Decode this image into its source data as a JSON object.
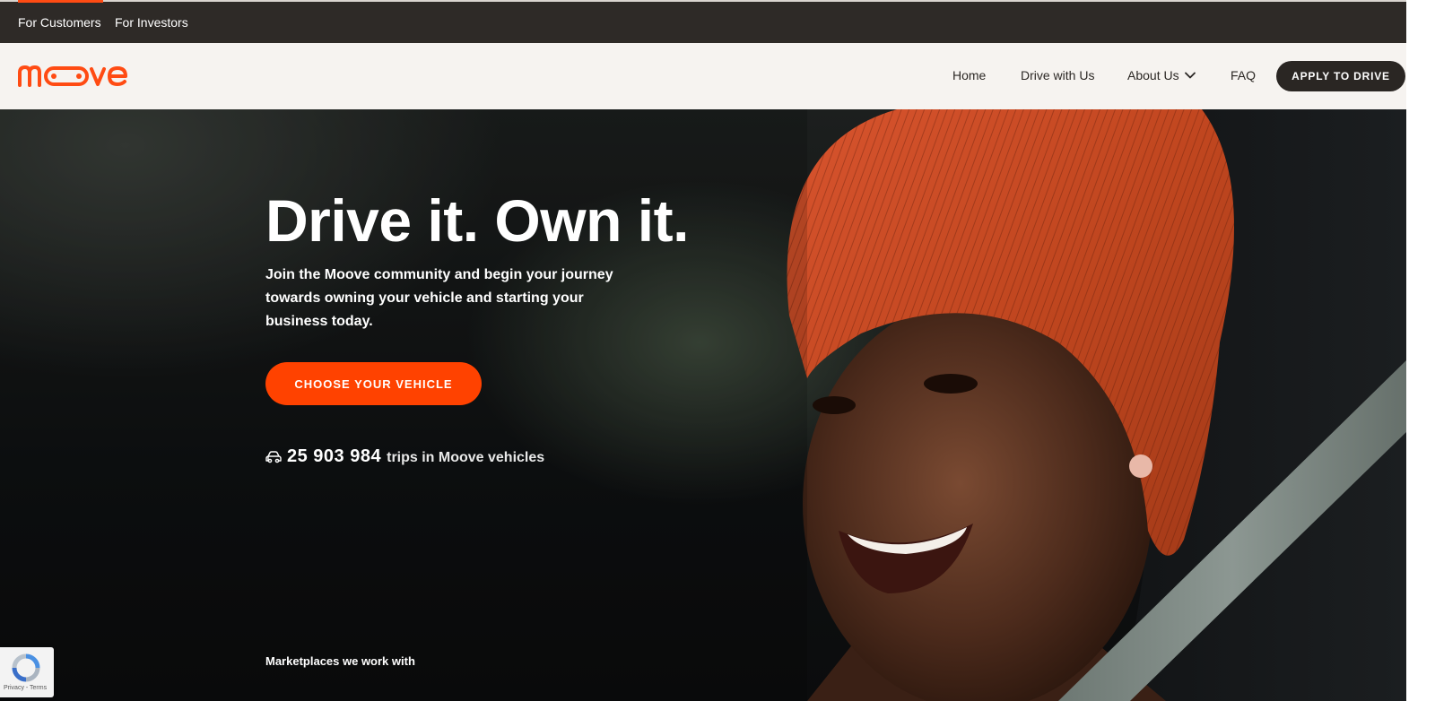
{
  "topbar": {
    "tabs": [
      {
        "label": "For Customers",
        "active": true
      },
      {
        "label": "For Investors",
        "active": false
      }
    ]
  },
  "brand": {
    "name": "moove",
    "accent_color": "#ff4b13"
  },
  "nav": {
    "items": [
      {
        "label": "Home"
      },
      {
        "label": "Drive with Us"
      },
      {
        "label": "About Us",
        "icon": "chevron-down-icon"
      },
      {
        "label": "FAQ"
      }
    ],
    "apply_label": "APPLY TO DRIVE"
  },
  "hero": {
    "title": "Drive it. Own it.",
    "subtitle": "Join the Moove community and begin your journey towards owning your vehicle and starting your business today.",
    "cta_label": "CHOOSE YOUR VEHICLE",
    "trips_icon": "car-icon",
    "trips_count": "25 903 984",
    "trips_label": "trips in Moove vehicles",
    "marketplaces_label": "Marketplaces we work with"
  },
  "recaptcha": {
    "text": "Privacy - Terms"
  }
}
